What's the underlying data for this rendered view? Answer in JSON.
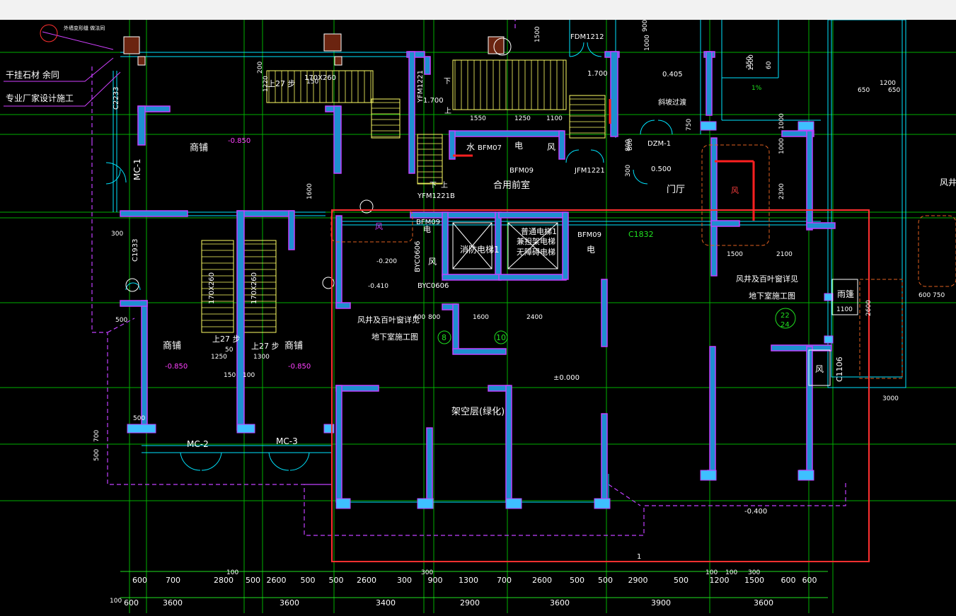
{
  "window": {
    "title": ""
  },
  "colors": {
    "background": "#000000",
    "wall_fill": "#1e8fd0",
    "wall_edge": "#c040ff",
    "grid": "#00c000",
    "text": "#ffffff",
    "dim": "#20e020",
    "cyan": "#00e5ff",
    "yellow": "#ffff66",
    "magenta": "#d040ff",
    "selection": "#ff3030",
    "column": "#6b2410"
  },
  "notes": {
    "stone_1": "干挂石材 余同",
    "stone_2": "专业厂家设计施工",
    "callout": "外墙变形缝 做法同"
  },
  "rooms": {
    "shop_1": "商铺",
    "shop_2": "商铺",
    "shop_3": "商铺",
    "shared_lobby": "合用前室",
    "entrance_hall": "门厅",
    "fire_elevator": "消防电梯1",
    "normal_elevator_1": "普通电梯1",
    "normal_elevator_2": "兼担架电梯",
    "normal_elevator_3": "无障碍电梯",
    "overhead_floor": "架空层(绿化)",
    "canopy": "雨篷",
    "water": "水",
    "electric_1": "电",
    "electric_2": "电",
    "electric_3": "电",
    "wind_1": "风",
    "wind_2": "风",
    "wind_3": "风",
    "wind_4": "风",
    "wind_5": "风井"
  },
  "labels": {
    "fdm1212": "FDM1212",
    "jfm1221": "JFM1221",
    "bfm07": "BFM07",
    "bfm09a": "BFM09",
    "bfm09b": "BFM09",
    "bfm09c": "BFM09",
    "yfm1221a": "YFM1221",
    "yfm1221b": "YFM1221B",
    "zdm1": "DZM-1",
    "mc1": "MC-1",
    "mc2": "MC-2",
    "mc3": "MC-3",
    "c1832": "C1832",
    "c1106": "C1106",
    "c1933": "C1933",
    "c2233": "C2233",
    "byc0606a": "BYC0606",
    "byc0606b": "BYC0606",
    "slope": "斜坡过渡",
    "shaft_note_1": "风井及百叶窗详见",
    "shaft_note_2": "地下室施工图",
    "shaft_note_3": "风井及百叶窗详见",
    "shaft_note_4": "地下室施工图",
    "steps_1": "上27 步",
    "steps_2": "上27 步",
    "steps_3": "上27 步",
    "stair_size_1": "170X260",
    "stair_size_2": "170X260",
    "stair_size_3": "170X260",
    "axis_8": "8",
    "axis_10": "10",
    "frac_top": "22",
    "frac_bot": "24",
    "up_1": "上",
    "up_2": "上",
    "down_1": "下",
    "down_2": "下",
    "wind_red": "风",
    "corner_1": "1"
  },
  "levels": {
    "l1": "-0.850",
    "l2": "-0.850",
    "l3": "-0.850",
    "l4": "-0.200",
    "l5": "-0.410",
    "l6": "±0.000",
    "l7": "-0.400",
    "l8": "1.700",
    "l9": "1.700",
    "l10": "0.500",
    "l11": "0.405",
    "slope_pct": "1%"
  },
  "dims": {
    "bottom_row1": [
      "600",
      "700",
      "2800",
      "500",
      "2600",
      "500",
      "500",
      "2600",
      "300",
      "900",
      "1300",
      "700",
      "2600",
      "500",
      "500",
      "2900",
      "500",
      "1200",
      "1500",
      "600",
      "600"
    ],
    "bottom_row2": [
      "600",
      "3600",
      "3600",
      "3400",
      "2900",
      "3600",
      "3900",
      "3600"
    ],
    "bottom_extra": [
      "100",
      "100",
      "100",
      "100",
      "300",
      "300"
    ],
    "inner": [
      "1250",
      "1300",
      "150",
      "100",
      "50",
      "800",
      "400",
      "1600",
      "2400",
      "1500",
      "2100",
      "1100",
      "1250",
      "1550",
      "1100",
      "800",
      "300",
      "1600",
      "1220",
      "200",
      "150",
      "3000",
      "650",
      "1200",
      "650",
      "750",
      "600",
      "300",
      "500",
      "500",
      "700",
      "500",
      "1000",
      "2300",
      "750",
      "800",
      "1500",
      "900",
      "1000",
      "1500",
      "250",
      "60",
      "1000",
      "2600"
    ]
  }
}
